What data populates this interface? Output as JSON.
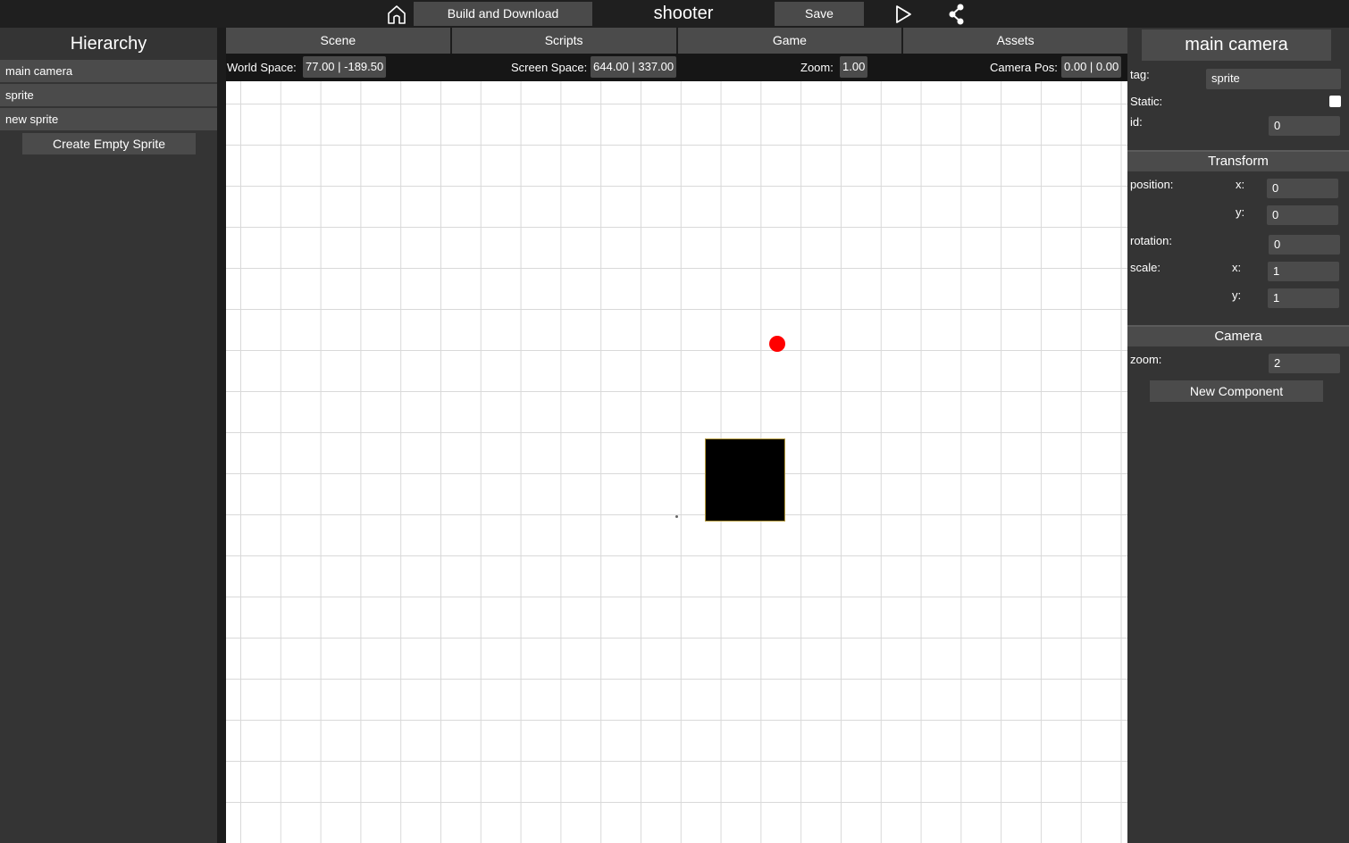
{
  "topbar": {
    "home_icon": "home-icon",
    "build_label": "Build and Download",
    "project_title": "shooter",
    "save_label": "Save",
    "play_icon": "play-icon",
    "share_icon": "share-icon"
  },
  "hierarchy": {
    "title": "Hierarchy",
    "items": [
      {
        "label": "main camera"
      },
      {
        "label": "sprite"
      },
      {
        "label": "new sprite"
      }
    ],
    "create_label": "Create Empty Sprite"
  },
  "tabs": [
    {
      "label": "Scene"
    },
    {
      "label": "Scripts"
    },
    {
      "label": "Game"
    },
    {
      "label": "Assets"
    }
  ],
  "infobar": {
    "world_label": "World Space:",
    "world_value": "77.00 | -189.50",
    "screen_label": "Screen Space:",
    "screen_value": "644.00 | 337.00",
    "zoom_label": "Zoom:",
    "zoom_value": "1.00",
    "campos_label": "Camera Pos:",
    "campos_value": "0.00 | 0.00"
  },
  "inspector": {
    "name": "main camera",
    "tag_label": "tag:",
    "tag_value": "sprite",
    "static_label": "Static:",
    "static_checked": false,
    "id_label": "id:",
    "id_value": "0",
    "transform": {
      "title": "Transform",
      "position_label": "position:",
      "x_label": "x:",
      "y_label": "y:",
      "pos_x": "0",
      "pos_y": "0",
      "rotation_label": "rotation:",
      "rotation": "0",
      "scale_label": "scale:",
      "scale_x": "1",
      "scale_y": "1"
    },
    "camera": {
      "title": "Camera",
      "zoom_label": "zoom:",
      "zoom": "2"
    },
    "new_component_label": "New Component"
  },
  "colors": {
    "background": "#2f2f2f",
    "panel": "#343434",
    "button": "#4b4b4b",
    "topbar": "#1f1f1f",
    "scene": "#ffffff",
    "marker": "#ff0000",
    "sprite": "#000000"
  }
}
